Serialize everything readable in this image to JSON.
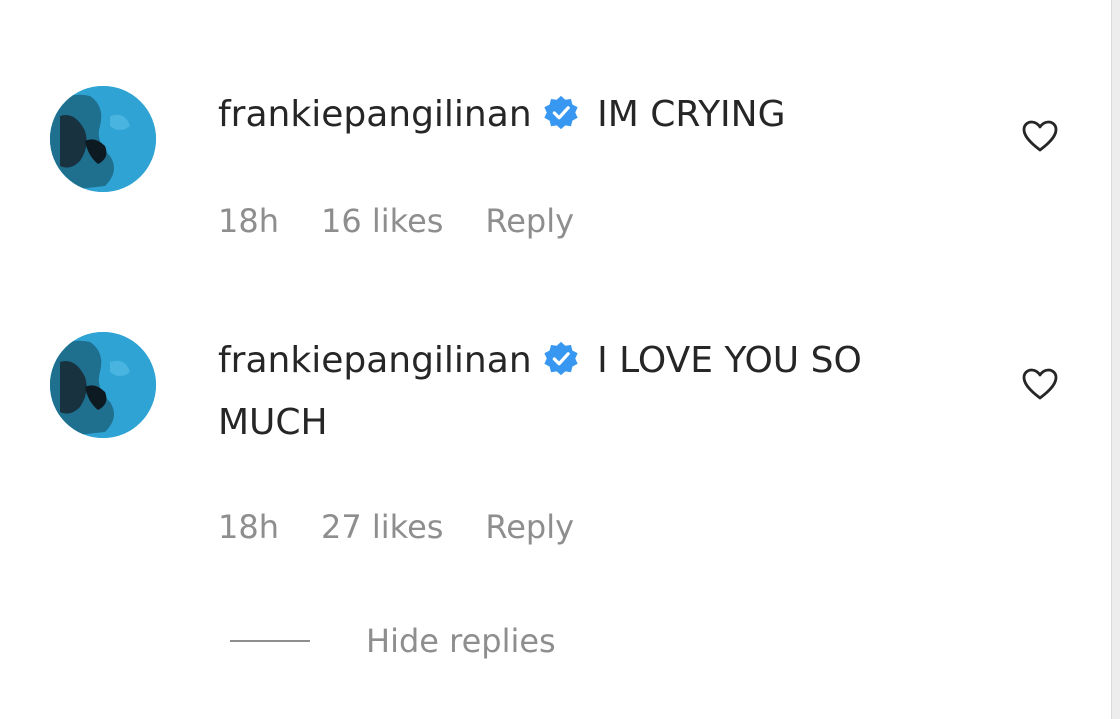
{
  "comments": [
    {
      "username": "frankiepangilinan",
      "verified": true,
      "text": "IM CRYING",
      "time": "18h",
      "likes": "16 likes",
      "reply_label": "Reply",
      "icons": {
        "avatar": "avatar",
        "verified": "verified-badge-icon",
        "like": "heart-outline-icon"
      }
    },
    {
      "username": "frankiepangilinan",
      "verified": true,
      "text": "I LOVE YOU SO MUCH",
      "time": "18h",
      "likes": "27 likes",
      "reply_label": "Reply",
      "icons": {
        "avatar": "avatar",
        "verified": "verified-badge-icon",
        "like": "heart-outline-icon"
      }
    }
  ],
  "hide_replies_label": "Hide replies",
  "colors": {
    "text": "#262626",
    "secondary": "#8e8e8e",
    "verified_blue": "#3897f0",
    "avatar_blue": "#2fa3d4"
  }
}
